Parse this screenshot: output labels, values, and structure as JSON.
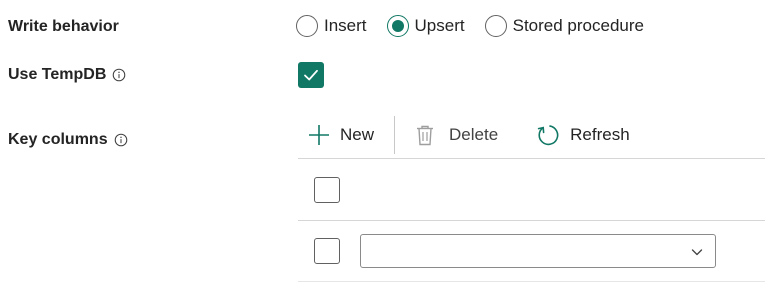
{
  "fields": {
    "write_behavior": {
      "label": "Write behavior",
      "options": [
        "Insert",
        "Upsert",
        "Stored procedure"
      ],
      "selected": "Upsert"
    },
    "use_tempdb": {
      "label": "Use TempDB",
      "checked": true
    },
    "key_columns": {
      "label": "Key columns",
      "toolbar": {
        "new_label": "New",
        "delete_label": "Delete",
        "refresh_label": "Refresh"
      },
      "rows": [
        {
          "checked": false,
          "has_select": false,
          "value": ""
        },
        {
          "checked": false,
          "has_select": true,
          "value": ""
        }
      ]
    }
  },
  "icons": {
    "info": "info-icon",
    "checkmark": "checkmark-icon",
    "add": "plus-icon",
    "delete": "trash-icon",
    "refresh": "refresh-icon",
    "dropdown": "chevron-down-icon"
  },
  "colors": {
    "accent": "#117865",
    "text": "#242424",
    "border": "#616161"
  }
}
